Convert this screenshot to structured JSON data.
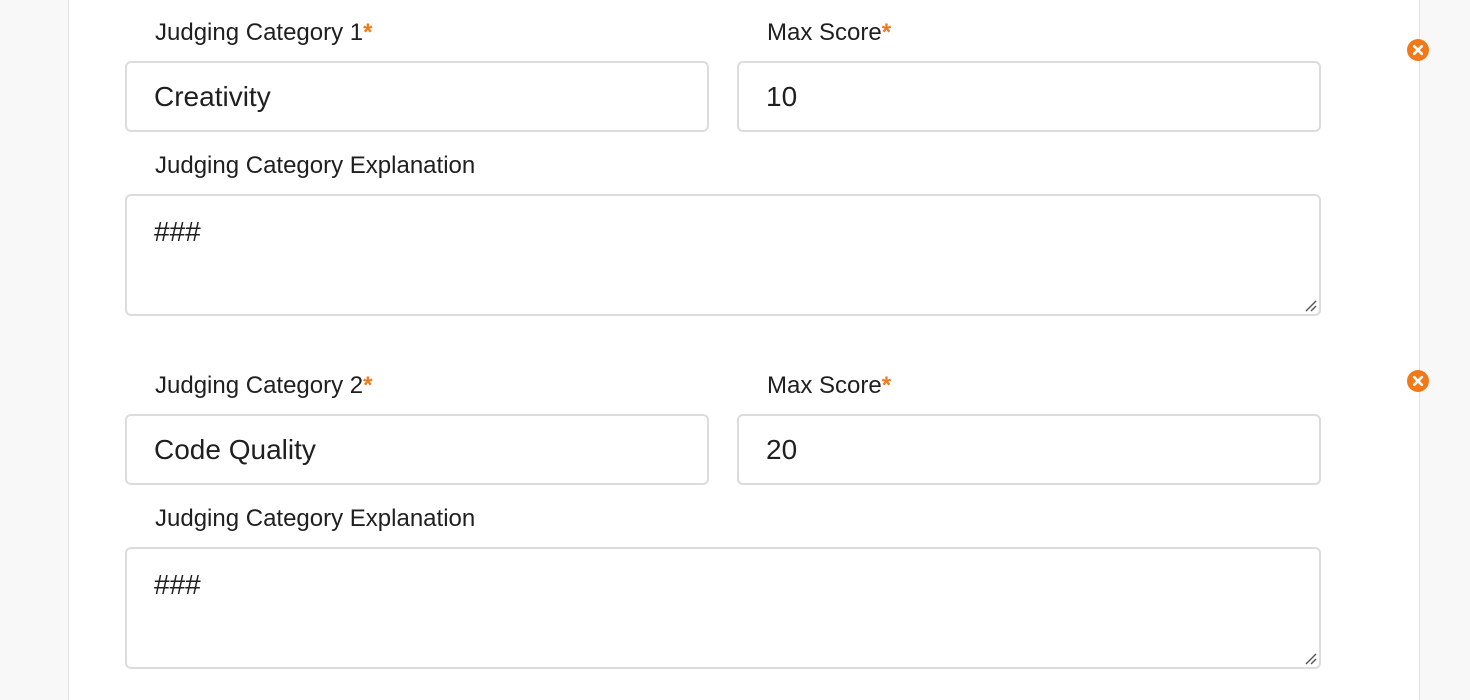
{
  "colors": {
    "accent": "#f07a1a",
    "border": "#dcdcdc",
    "background": "#f8f8f8"
  },
  "categories": [
    {
      "category_label": "Judging Category 1",
      "required_mark": "*",
      "category_value": "Creativity",
      "max_score_label": "Max Score",
      "max_score_value": "10",
      "explanation_label": "Judging Category Explanation",
      "explanation_value": "###",
      "remove_icon": "close-circle-icon"
    },
    {
      "category_label": "Judging Category 2",
      "required_mark": "*",
      "category_value": "Code Quality",
      "max_score_label": "Max Score",
      "max_score_value": "20",
      "explanation_label": "Judging Category Explanation",
      "explanation_value": "###",
      "remove_icon": "close-circle-icon"
    }
  ]
}
